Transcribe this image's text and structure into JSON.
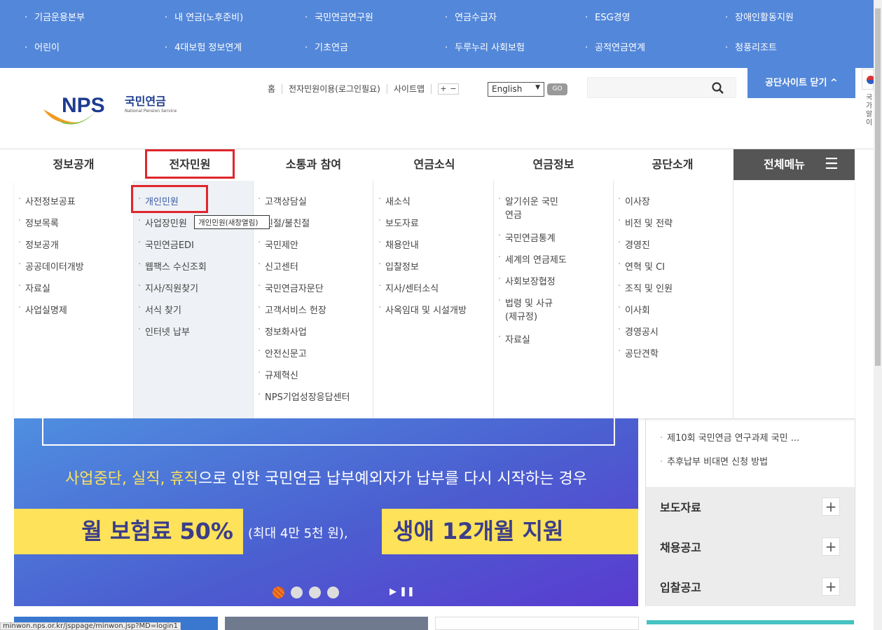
{
  "top_links": [
    "기금운용본부",
    "내 연금(노후준비)",
    "국민연금연구원",
    "연금수급자",
    "ESG경영",
    "장애인활동지원",
    "어린이",
    "4대보험 정보연계",
    "기초연금",
    "두루누리 사회보험",
    "공적연금연계",
    "청풍리조트"
  ],
  "logo": {
    "text": "NPS",
    "korean": "국민연금",
    "english": "National Pension Service"
  },
  "util": {
    "home": "홈",
    "eservice": "전자민원이용(로그인필요)",
    "sitemap": "사이트맵",
    "plus": "+",
    "minus": "−",
    "language": "English",
    "go": "GO"
  },
  "close_site": "공단사이트 닫기 ^",
  "flag_text": "국가 알이",
  "nav": [
    "정보공개",
    "전자민원",
    "소통과 참여",
    "연금소식",
    "연금정보",
    "공단소개"
  ],
  "all_menu": "전체메뉴",
  "dropdown": [
    [
      "사전정보공표",
      "정보목록",
      "정보공개",
      "공공데이터개방",
      "자료실",
      "사업실명제"
    ],
    [
      "개인민원",
      "사업장민원",
      "국민연금EDI",
      "웹팩스 수신조회",
      "지사/직원찾기",
      "서식 찾기",
      "인터넷 납부"
    ],
    [
      "고객상담실",
      "친절/불친절",
      "국민제안",
      "신고센터",
      "국민연금자문단",
      "고객서비스 헌장",
      "정보화사업",
      "안전신문고",
      "규제혁신",
      "NPS기업성장응답센터"
    ],
    [
      "새소식",
      "보도자료",
      "채용안내",
      "입찰정보",
      "지사/센터소식",
      "사옥임대 및 시설개방"
    ],
    [
      "알기쉬운 국민연금",
      "국민연금통계",
      "세계의 연금제도",
      "사회보장협정",
      "법령 및 사규(제규정)",
      "자료실"
    ],
    [
      "이사장",
      "비전 및 전략",
      "경영진",
      "연혁 및 CI",
      "조직 및 인원",
      "이사회",
      "경영공시",
      "공단견학"
    ]
  ],
  "tooltip": "개인민원(새창열림)",
  "banner": {
    "line1_highlight": "사업중단, 실직, 휴직",
    "line1_rest": "으로 인한 국민연금 납부예외자가 납부를 다시 시작하는 경우",
    "box1": "월 보험료 50%",
    "middle": "(최대 4만 5천 원),",
    "box2": "생애 12개월 지원",
    "slide_count": 4,
    "active_slide": 1
  },
  "side": {
    "news": [
      "제10회 국민연금 연구과제 국민 ...",
      "추후납부 비대면 신청 방법"
    ],
    "sections": [
      "보도자료",
      "채용공고",
      "입찰공고"
    ],
    "plus": "+"
  },
  "status_url": "minwon.nps.or.kr/jsppage/minwon.jsp?MD=login1",
  "colors": {
    "topbar": "#5387d9",
    "highlight": "#e0262d",
    "banner_yellow": "#fde25a"
  }
}
